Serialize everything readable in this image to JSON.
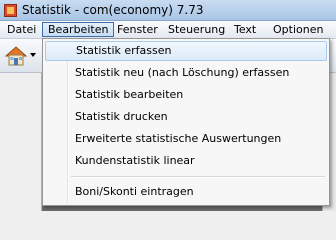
{
  "window": {
    "title": "Statistik - com(economy) 7.73"
  },
  "menubar": {
    "items": [
      "Datei",
      "Bearbeiten",
      "Fenster",
      "Steuerung",
      "Text",
      "Optionen"
    ]
  },
  "dropdown": {
    "items": [
      "Statistik erfassen",
      "Statistik neu (nach Löschung) erfassen",
      "Statistik bearbeiten",
      "Statistik drucken",
      "Erweiterte statistische Auswertungen",
      "Kundenstatistik linear",
      "Boni/Skonti eintragen"
    ]
  }
}
